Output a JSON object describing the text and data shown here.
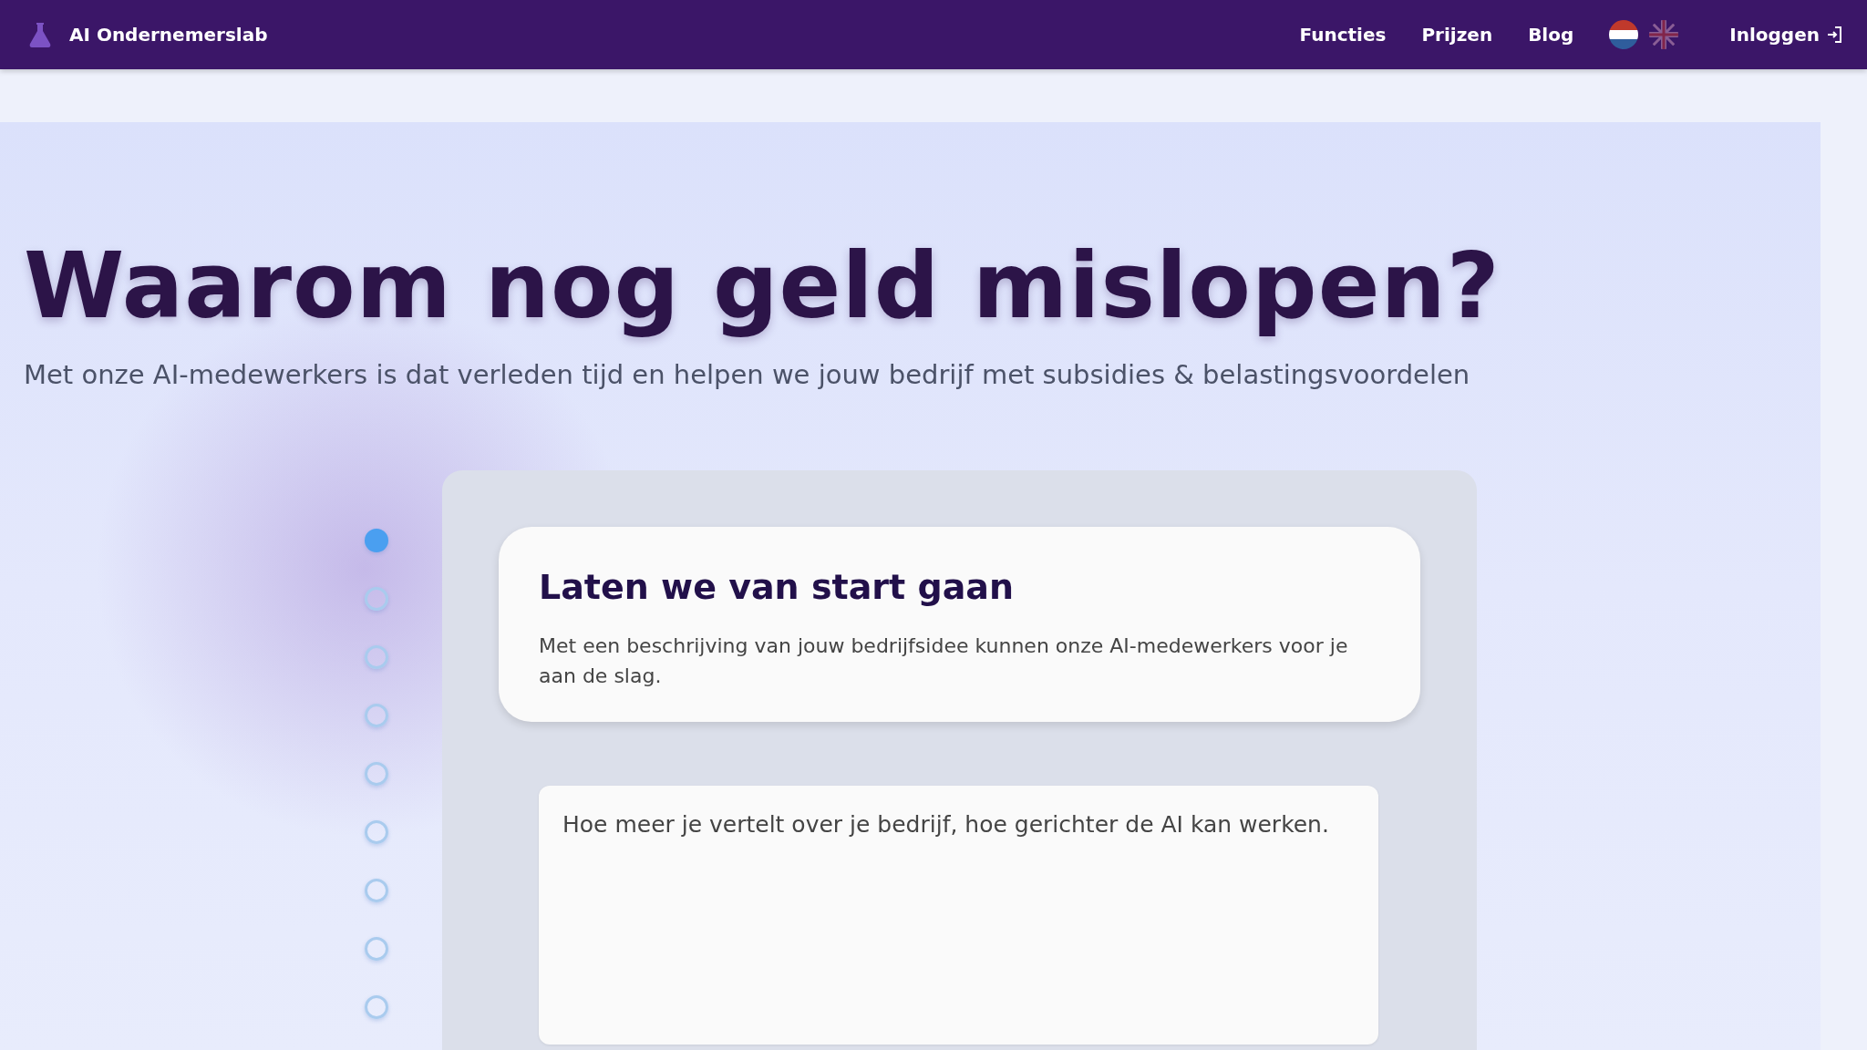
{
  "nav": {
    "brand": "AI Ondernemerslab",
    "links": [
      "Functies",
      "Prijzen",
      "Blog"
    ],
    "languages": [
      {
        "kind": "nl",
        "selected": true
      },
      {
        "kind": "en",
        "selected": false
      }
    ],
    "login": "Inloggen"
  },
  "hero": {
    "title": "Waarom nog geld mislopen?",
    "subtitle": "Met onze AI-medewerkers is dat verleden tijd en helpen we jouw bedrijf met subsidies & belastingsvoordelen"
  },
  "steps": [
    {
      "selected": true
    },
    {
      "selected": false
    },
    {
      "selected": false
    },
    {
      "selected": false
    },
    {
      "selected": false
    },
    {
      "selected": false
    },
    {
      "selected": false
    },
    {
      "selected": false
    },
    {
      "selected": false
    }
  ],
  "card": {
    "title": "Laten we van start gaan",
    "text": "Met een beschrijving van jouw bedrijfsidee kunnen onze AI-medewerkers voor je aan de slag."
  },
  "description": {
    "placeholder": "Hoe meer je vertelt over je bedrijf, hoe gerichter de AI kan werken."
  }
}
